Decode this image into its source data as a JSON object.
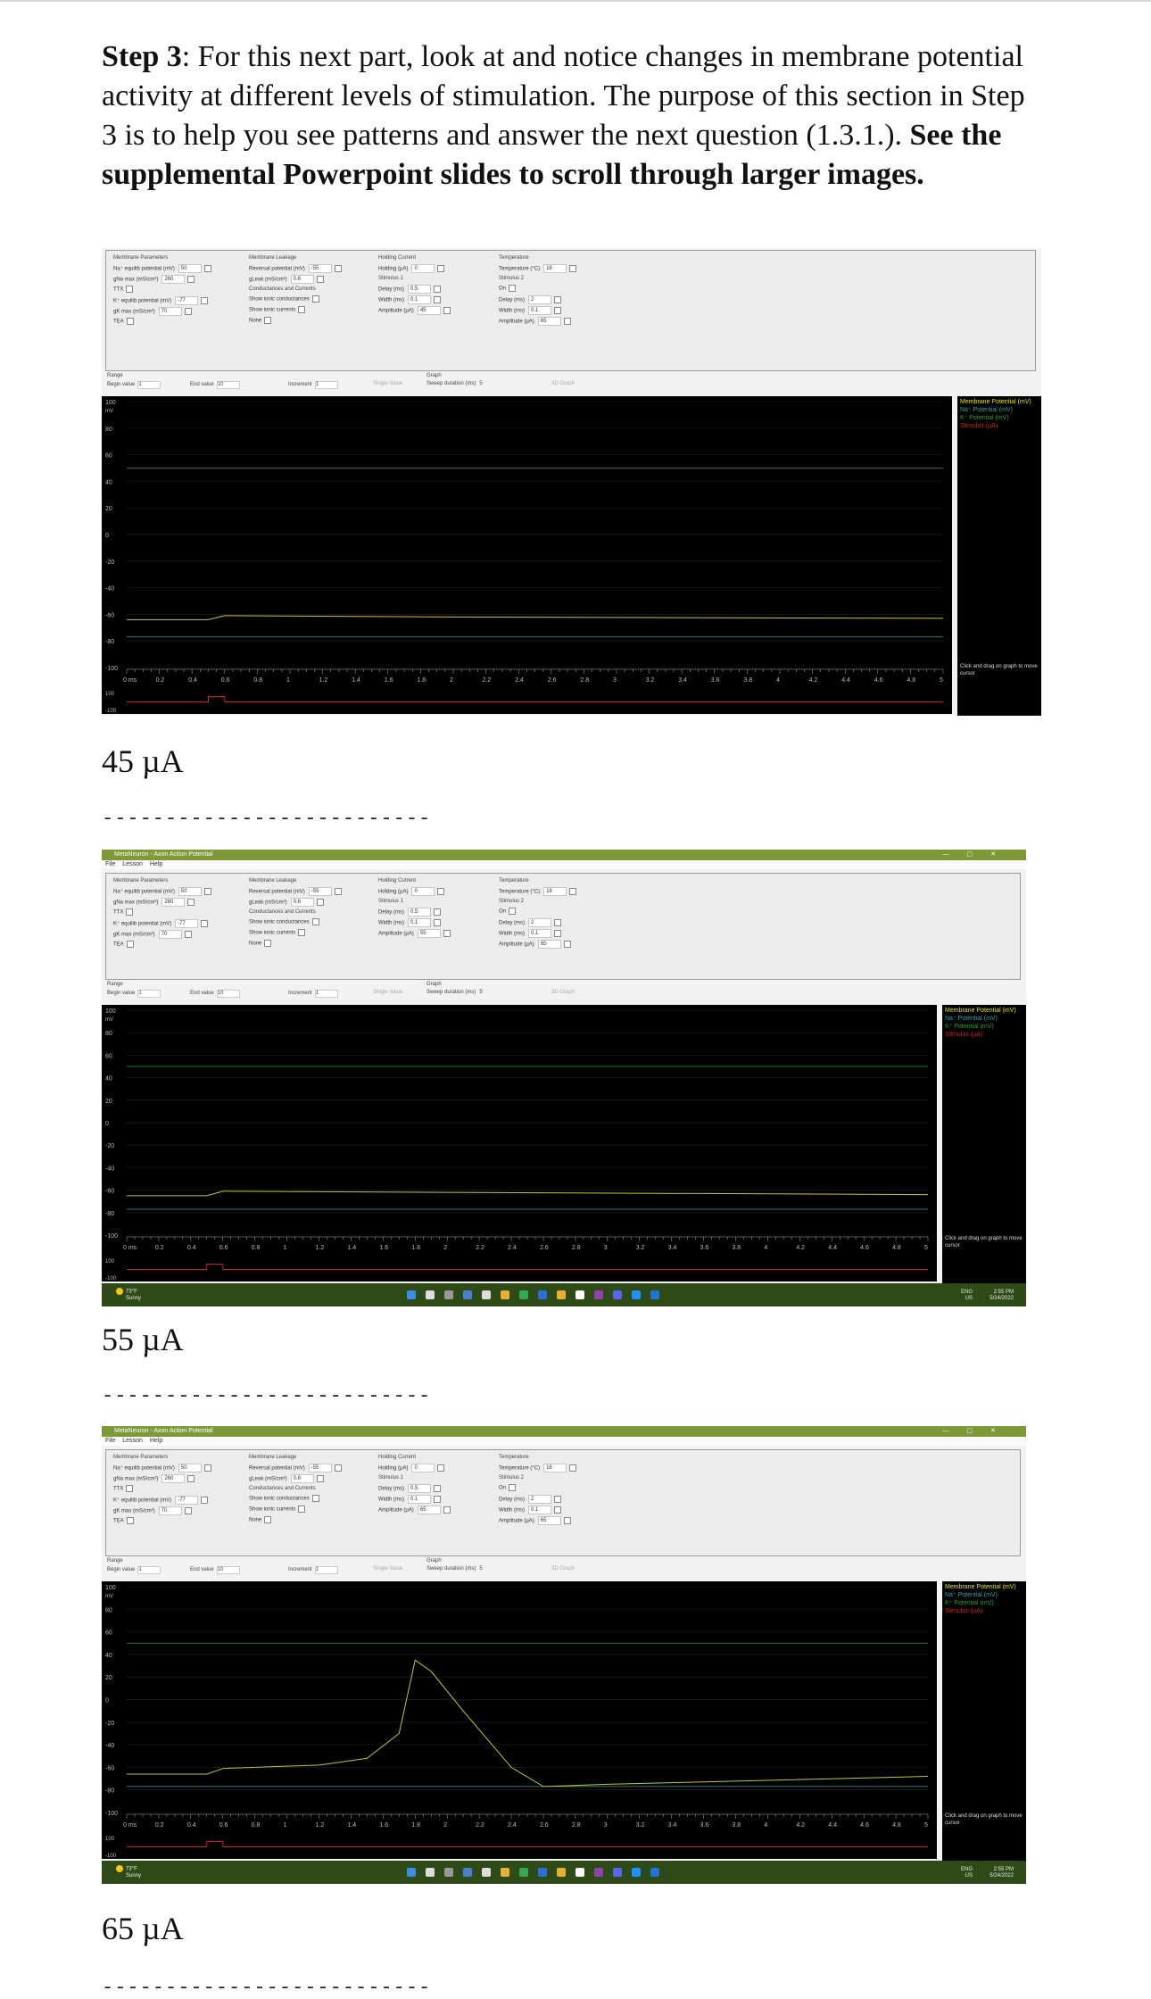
{
  "intro": {
    "step": "Step 3",
    "text": ": For this next part, look at and notice changes in membrane potential activity at different levels of stimulation. The purpose of this section in Step 3 is to help you see patterns and answer the next question (1.3.1.). ",
    "bold": "See the supplemental Powerpoint slides to scroll through larger images."
  },
  "separator": "--------------------------",
  "app": {
    "window_title": "MetaNeuron - Axon Action Potential",
    "menu": [
      "File",
      "Lesson",
      "Help"
    ],
    "groups": {
      "membrane_params": "Membrane Parameters",
      "membrane_leakage": "Membrane Leakage",
      "holding_current": "Holding Current",
      "temperature": "Temperature",
      "stimulus1": "Stimulus 1",
      "stimulus2": "Stimulus 2",
      "cond_currents": "Conductances and Currents",
      "range": "Range",
      "graph": "Graph"
    },
    "fields": {
      "na_equil": "Na⁺ equilib potential (mV)",
      "na_equil_val": "50",
      "gna_max": "gNa max (mS/cm²)",
      "gna_max_val": "260",
      "ttx": "TTX",
      "k_equil": "K⁺ equilib potential (mV)",
      "k_equil_val": "-77",
      "gk_max": "gK max (mS/cm²)",
      "gk_max_val": "70",
      "tea": "TEA",
      "reversal": "Reversal potential (mV)",
      "reversal_val": "-55",
      "gleak": "gLeak (mS/cm²)",
      "gleak_val": "0.6",
      "show_cond": "Show ionic conductances",
      "show_curr": "Show ionic currents",
      "none": "None",
      "holding": "Holding (µA)",
      "holding_val": "0",
      "delay": "Delay (ms)",
      "delay1_val": "0.5",
      "width": "Width (ms)",
      "width1_val": "0.1",
      "amplitude": "Amplitude (µA)",
      "temp": "Temperature (°C)",
      "temp_val": "18",
      "on": "On",
      "delay2_val": "2",
      "width2_val": "0.1",
      "amp2_val": "65",
      "begin": "Begin value",
      "begin_val": "1",
      "end": "End value",
      "end_val": "10",
      "increment": "Increment",
      "increment_val": "1",
      "single": "Single Value",
      "sweep": "Sweep duration (ms)",
      "sweep_val": "5",
      "graph3d": "3D Graph"
    },
    "legend": [
      "Membrane Potential (mV)",
      "Na⁺ Potential (mV)",
      "K⁺ Potential (mV)",
      "Stimulus (µA)"
    ],
    "help": "Click and drag on graph to move cursor",
    "y_ticks": [
      "100",
      "80",
      "60",
      "40",
      "20",
      "0",
      "-20",
      "-40",
      "-60",
      "-80",
      "-100"
    ],
    "x_ticks": [
      "0 ms",
      "0.2",
      "0.4",
      "0.6",
      "0.8",
      "1",
      "1.2",
      "1.4",
      "1.6",
      "1.8",
      "2",
      "2.2",
      "2.4",
      "2.6",
      "2.8",
      "3",
      "3.2",
      "3.4",
      "3.6",
      "3.8",
      "4",
      "4.2",
      "4.4",
      "4.6",
      "4.8",
      "5"
    ],
    "stim_ticks": [
      "100",
      "-100"
    ],
    "unit": "mV",
    "taskbar": {
      "temp": "73°F",
      "cond": "Sunny",
      "lang": "ENG",
      "region": "US",
      "time": "2:55 PM",
      "date": "5/24/2022"
    }
  },
  "panels": [
    {
      "caption": "45 µA",
      "amp": "45"
    },
    {
      "caption": "55 µA",
      "amp": "55"
    },
    {
      "caption": "65 µA",
      "amp": "65"
    }
  ],
  "chart_data": [
    {
      "type": "line",
      "x": [
        0,
        0.5,
        0.6,
        2.0,
        5.0
      ],
      "y": [
        -64,
        -64,
        -61,
        -62,
        -63
      ],
      "ylim": [
        -100,
        100
      ],
      "xlim": [
        0,
        5
      ],
      "series_refs": [
        {
          "values": [
            50
          ],
          "color": "#2aa02a"
        },
        {
          "values": [
            -77
          ],
          "color": "#2aa8a8"
        }
      ]
    },
    {
      "type": "line",
      "x": [
        0,
        0.5,
        0.6,
        2.0,
        5.0
      ],
      "y": [
        -65,
        -65,
        -61,
        -62,
        -64
      ],
      "ylim": [
        -100,
        100
      ],
      "xlim": [
        0,
        5
      ]
    },
    {
      "type": "line",
      "x": [
        0,
        0.5,
        0.6,
        1.2,
        1.5,
        1.7,
        1.8,
        1.9,
        2.1,
        2.4,
        2.6,
        3.0,
        5.0
      ],
      "y": [
        -66,
        -66,
        -61,
        -58,
        -52,
        -30,
        35,
        25,
        -10,
        -60,
        -77,
        -75,
        -68
      ],
      "ylim": [
        -100,
        100
      ],
      "xlim": [
        0,
        5
      ]
    }
  ]
}
